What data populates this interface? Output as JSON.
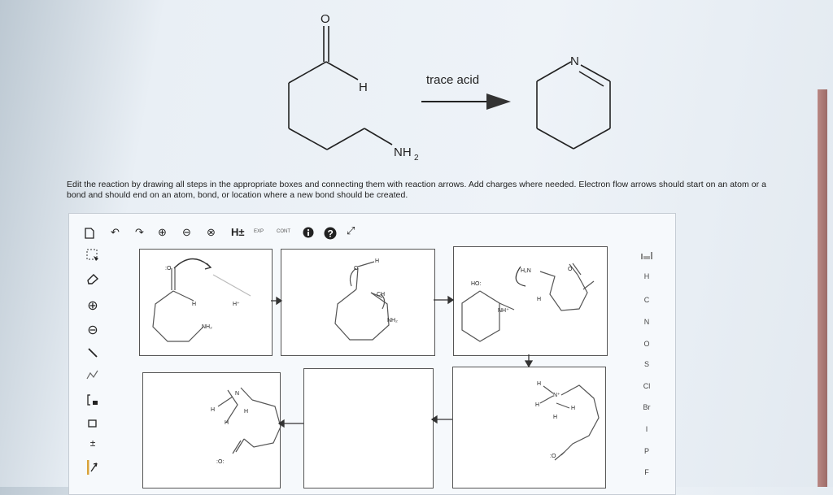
{
  "reaction": {
    "reactant_labels": {
      "oxygen": "O",
      "hydrogen": "H",
      "amine": "NH",
      "amine_sub": "2"
    },
    "condition": "trace acid",
    "product_labels": {
      "nitrogen": "N"
    }
  },
  "instructions": "Edit the reaction by drawing all steps in the appropriate boxes and connecting them with reaction arrows. Add charges where needed. Electron flow arrows should start on an atom or a bond and should end on an atom, bond, or location where a new bond should be created.",
  "toolbar": {
    "items": [
      {
        "name": "new-document-icon",
        "glyph": "🗋"
      },
      {
        "name": "undo-icon",
        "glyph": "↶"
      },
      {
        "name": "redo-icon",
        "glyph": "↷"
      },
      {
        "name": "zoom-in-icon",
        "glyph": "⊕"
      },
      {
        "name": "zoom-out-icon",
        "glyph": "⊖"
      },
      {
        "name": "zoom-reset-icon",
        "glyph": "⊗"
      },
      {
        "name": "hydrogen-toggle-icon",
        "glyph": "H±"
      },
      {
        "name": "explicit-icon",
        "glyph": "EXP"
      },
      {
        "name": "contract-icon",
        "glyph": "CONT"
      },
      {
        "name": "info-icon",
        "glyph": "❶"
      },
      {
        "name": "help-icon",
        "glyph": "?"
      },
      {
        "name": "fullscreen-icon",
        "glyph": "⤢"
      }
    ],
    "hydrogen_label": "H±",
    "exp_label": "EXP",
    "cont_label": "CONT"
  },
  "left_tools": [
    {
      "name": "select-tool-icon",
      "glyph": "⬚"
    },
    {
      "name": "eraser-tool-icon",
      "glyph": "⌫"
    },
    {
      "name": "positive-charge-icon",
      "glyph": "⊕"
    },
    {
      "name": "negative-charge-icon",
      "glyph": "⊖"
    },
    {
      "name": "bond-tool-icon",
      "glyph": "/"
    },
    {
      "name": "chain-tool-icon",
      "glyph": "〰"
    },
    {
      "name": "bracket-tool-icon",
      "glyph": "[⁝"
    },
    {
      "name": "ring-tool-icon",
      "glyph": "□"
    },
    {
      "name": "charge-tool-icon",
      "glyph": "±"
    },
    {
      "name": "arrow-tool-icon",
      "glyph": "↗"
    }
  ],
  "elements": [
    "H",
    "C",
    "N",
    "O",
    "S",
    "Cl",
    "Br",
    "I",
    "P",
    "F"
  ],
  "boxes": {
    "box1": {
      "o": ":O",
      "h": "H",
      "hplus": "H⁺",
      "nh2": "NH₂"
    },
    "box2": {
      "o": "O",
      "h": "H",
      "ch": "CH",
      "nh2": "NH₂"
    },
    "box3": {
      "ho": "HO:",
      "h2n": "H₂N",
      "o": "O",
      "h": "H",
      "nh": "NH⁺"
    },
    "box4": {
      "n": "N",
      "h1": "H",
      "h2": "H",
      "h3": "H",
      "o": ":O:"
    },
    "box6": {
      "n": "N⁺",
      "h1": "H",
      "h2": "H",
      "h3": "H",
      "h4": "H",
      "o": ":O"
    }
  }
}
